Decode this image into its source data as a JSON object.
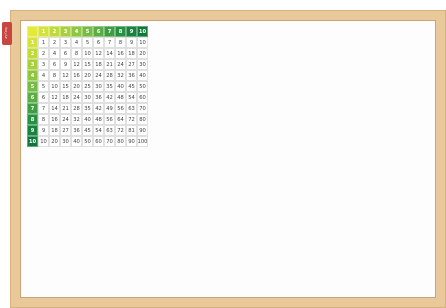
{
  "side_tab": {
    "label": "مدرسة",
    "color": "#c9453f"
  },
  "frame_color": "#e9c99a",
  "table": {
    "header_colors": [
      "#e5ea3a",
      "#d3e33a",
      "#bfda39",
      "#a8d03c",
      "#8fc63f",
      "#75bb44",
      "#59ad43",
      "#3e9f42",
      "#269140",
      "#16843c",
      "#0e773a"
    ],
    "top_header": [
      "",
      "1",
      "2",
      "3",
      "4",
      "5",
      "6",
      "7",
      "8",
      "9",
      "10"
    ],
    "rows": [
      {
        "head": "1",
        "cells": [
          "1",
          "2",
          "3",
          "4",
          "5",
          "6",
          "7",
          "8",
          "9",
          "10"
        ]
      },
      {
        "head": "2",
        "cells": [
          "2",
          "4",
          "6",
          "8",
          "10",
          "12",
          "14",
          "16",
          "18",
          "20"
        ]
      },
      {
        "head": "3",
        "cells": [
          "3",
          "6",
          "9",
          "12",
          "15",
          "18",
          "21",
          "24",
          "27",
          "30"
        ]
      },
      {
        "head": "4",
        "cells": [
          "4",
          "8",
          "12",
          "16",
          "20",
          "24",
          "28",
          "32",
          "36",
          "40"
        ]
      },
      {
        "head": "5",
        "cells": [
          "5",
          "10",
          "15",
          "20",
          "25",
          "30",
          "35",
          "40",
          "45",
          "50"
        ]
      },
      {
        "head": "6",
        "cells": [
          "6",
          "12",
          "18",
          "24",
          "30",
          "36",
          "42",
          "48",
          "54",
          "60"
        ]
      },
      {
        "head": "7",
        "cells": [
          "7",
          "14",
          "21",
          "28",
          "35",
          "42",
          "49",
          "56",
          "63",
          "70"
        ]
      },
      {
        "head": "8",
        "cells": [
          "8",
          "16",
          "24",
          "32",
          "40",
          "48",
          "56",
          "64",
          "72",
          "80"
        ]
      },
      {
        "head": "9",
        "cells": [
          "9",
          "18",
          "27",
          "36",
          "45",
          "54",
          "63",
          "72",
          "81",
          "90"
        ]
      },
      {
        "head": "10",
        "cells": [
          "10",
          "20",
          "30",
          "40",
          "50",
          "60",
          "70",
          "80",
          "90",
          "100"
        ]
      }
    ]
  }
}
